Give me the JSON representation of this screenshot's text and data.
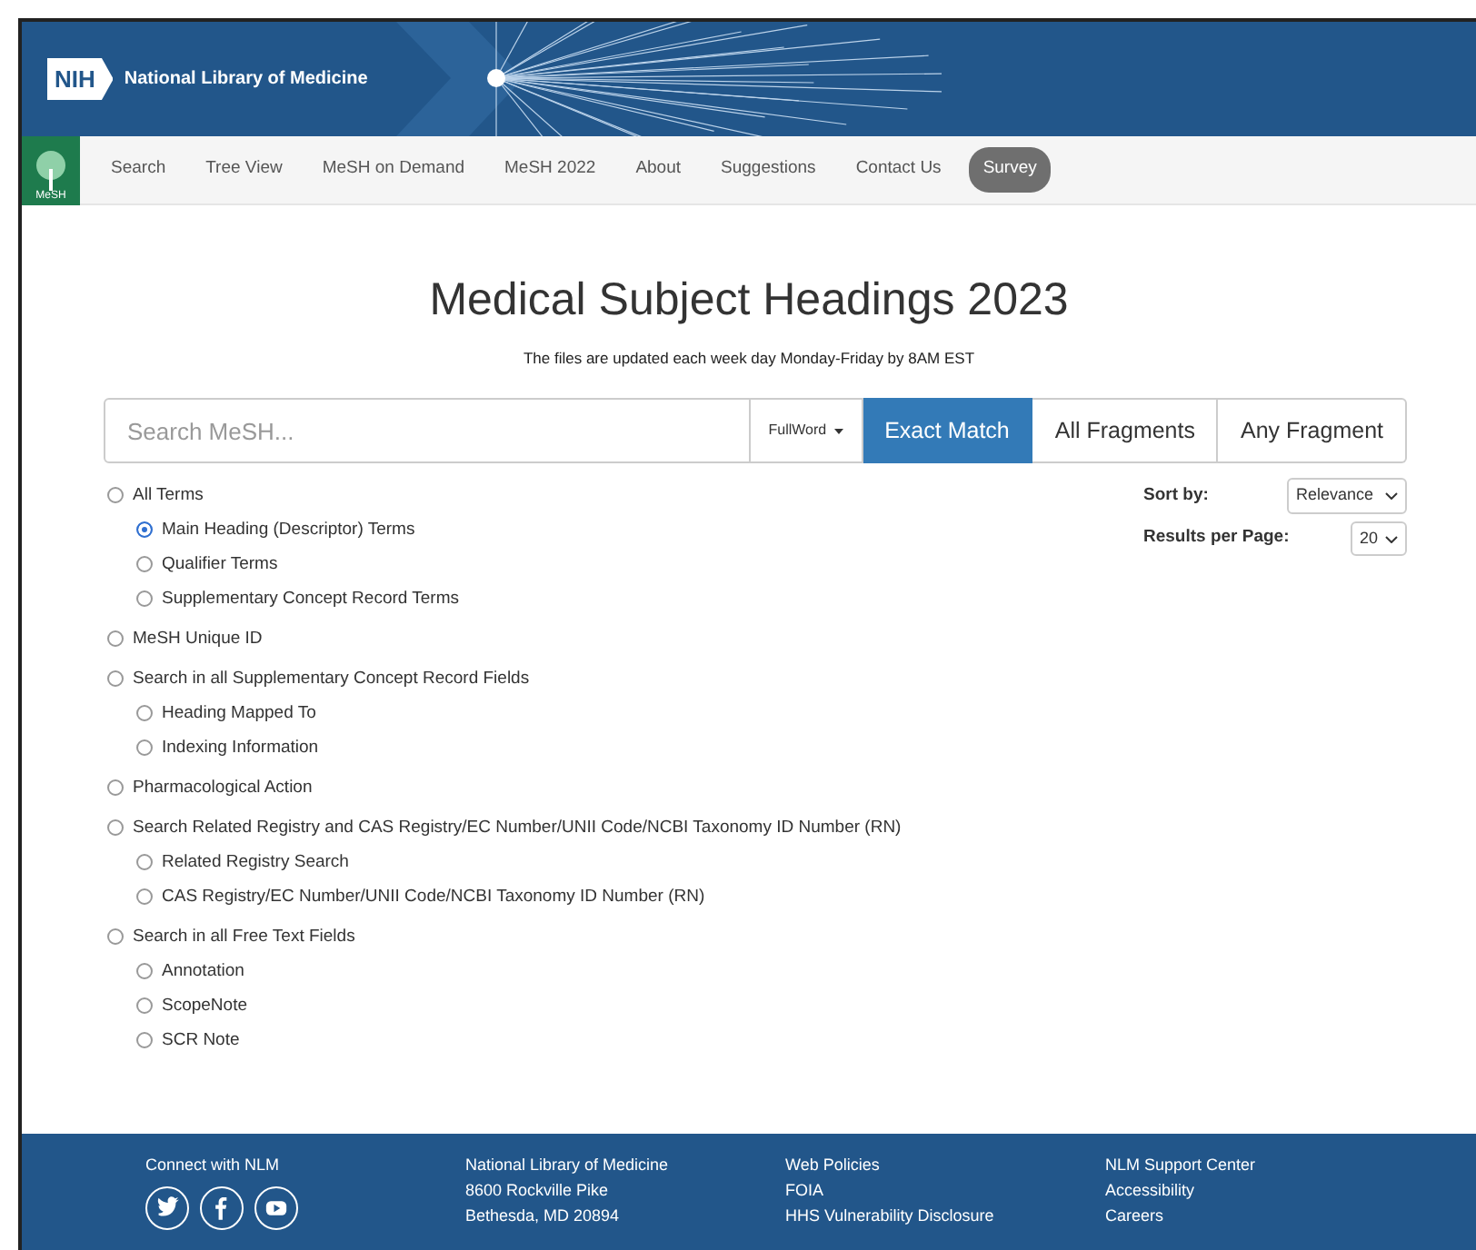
{
  "header": {
    "logo": "NIH",
    "title": "National Library of Medicine"
  },
  "nav": {
    "logo_text": "MeSH",
    "items": [
      {
        "label": "Search",
        "kind": "link"
      },
      {
        "label": "Tree View",
        "kind": "link"
      },
      {
        "label": "MeSH on Demand",
        "kind": "link"
      },
      {
        "label": "MeSH 2022",
        "kind": "link"
      },
      {
        "label": "About",
        "kind": "link"
      },
      {
        "label": "Suggestions",
        "kind": "link"
      },
      {
        "label": "Contact Us",
        "kind": "link"
      },
      {
        "label": "Survey",
        "kind": "pill"
      }
    ]
  },
  "page_title": "Medical Subject Headings 2023",
  "subtitle": "The files are updated each week day Monday-Friday by 8AM EST",
  "search": {
    "placeholder": "Search MeSH...",
    "dropdown": "FullWord",
    "modes": [
      {
        "label": "Exact Match",
        "selected": true
      },
      {
        "label": "All Fragments",
        "selected": false
      },
      {
        "label": "Any Fragment",
        "selected": false
      }
    ]
  },
  "options": [
    {
      "label": "All Terms",
      "selected": false,
      "children": [
        {
          "label": "Main Heading (Descriptor) Terms",
          "selected": true
        },
        {
          "label": "Qualifier Terms",
          "selected": false
        },
        {
          "label": "Supplementary Concept Record Terms",
          "selected": false
        }
      ]
    },
    {
      "label": "MeSH Unique ID",
      "selected": false
    },
    {
      "label": "Search in all Supplementary Concept Record Fields",
      "selected": false,
      "children": [
        {
          "label": "Heading Mapped To",
          "selected": false
        },
        {
          "label": "Indexing Information",
          "selected": false
        }
      ]
    },
    {
      "label": "Pharmacological Action",
      "selected": false
    },
    {
      "label": "Search Related Registry and CAS Registry/EC Number/UNII Code/NCBI Taxonomy ID Number (RN)",
      "selected": false,
      "children": [
        {
          "label": "Related Registry Search",
          "selected": false
        },
        {
          "label": "CAS Registry/EC Number/UNII Code/NCBI Taxonomy ID Number (RN)",
          "selected": false
        }
      ]
    },
    {
      "label": "Search in all Free Text Fields",
      "selected": false,
      "children": [
        {
          "label": "Annotation",
          "selected": false
        },
        {
          "label": "ScopeNote",
          "selected": false
        },
        {
          "label": "SCR Note",
          "selected": false
        }
      ]
    }
  ],
  "sort_by": {
    "label": "Sort by:",
    "value": "Relevance"
  },
  "results_per_page": {
    "label": "Results per Page:",
    "value": "20"
  },
  "footer": {
    "columns": [
      {
        "heading": "Connect with NLM",
        "social": [
          {
            "kind": "twitter"
          },
          {
            "kind": "facebook"
          },
          {
            "kind": "youtube"
          }
        ]
      },
      {
        "heading": "National Library of Medicine",
        "lines": [
          "8600 Rockville Pike",
          "Bethesda, MD 20894"
        ]
      },
      {
        "heading": "Web Policies",
        "lines": [
          "FOIA",
          "HHS Vulnerability Disclosure"
        ]
      },
      {
        "heading": "NLM Support Center",
        "lines": [
          "Accessibility",
          "Careers"
        ]
      }
    ]
  }
}
